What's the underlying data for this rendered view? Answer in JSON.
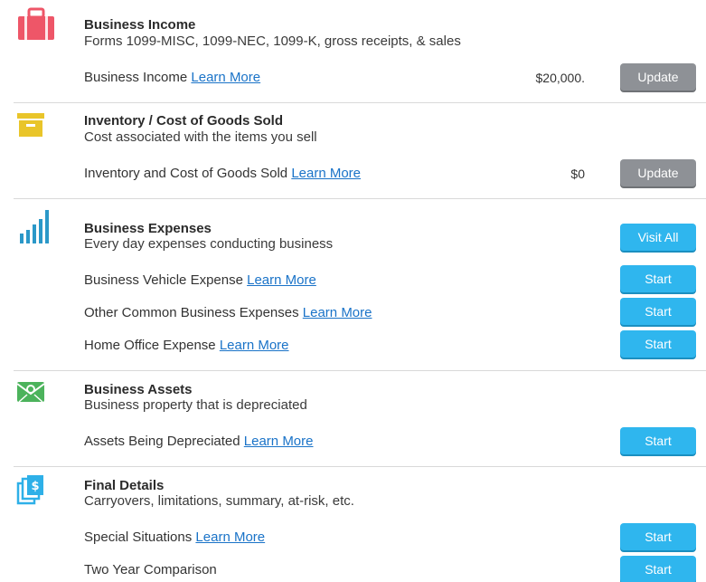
{
  "colors": {
    "briefcase": "#ee5668",
    "inventory": "#e9c52a",
    "expenses": "#2b98c8",
    "assets": "#4cb35c",
    "final": "#2eb0e8",
    "update_button": "#8e9196",
    "start_button": "#2fb6ee",
    "link": "#1a73c8"
  },
  "sections": {
    "income": {
      "icon": "briefcase-icon",
      "title": "Business Income",
      "subtitle": "Forms 1099-MISC, 1099-NEC, 1099-K, gross receipts, & sales",
      "rows": [
        {
          "label": "Business Income",
          "link": "Learn More",
          "amount": "$20,000.",
          "button": "Update"
        }
      ]
    },
    "inventory": {
      "icon": "archive-box-icon",
      "title": "Inventory / Cost of Goods Sold",
      "subtitle": "Cost associated with the items you sell",
      "rows": [
        {
          "label": "Inventory and Cost of Goods Sold",
          "link": "Learn More",
          "amount": "$0",
          "button": "Update"
        }
      ]
    },
    "expenses": {
      "icon": "bar-chart-icon",
      "title": "Business Expenses",
      "subtitle": "Every day expenses conducting business",
      "header_button": "Visit All",
      "rows": [
        {
          "label": "Business Vehicle Expense",
          "link": "Learn More",
          "button": "Start"
        },
        {
          "label": "Other Common Business Expenses",
          "link": "Learn More",
          "button": "Start"
        },
        {
          "label": "Home Office Expense",
          "link": "Learn More",
          "button": "Start"
        }
      ]
    },
    "assets": {
      "icon": "money-envelope-icon",
      "title": "Business Assets",
      "subtitle": "Business property that is depreciated",
      "rows": [
        {
          "label": "Assets Being Depreciated",
          "link": "Learn More",
          "button": "Start"
        }
      ]
    },
    "final": {
      "icon": "stacked-documents-dollar-icon",
      "title": "Final Details",
      "subtitle": "Carryovers, limitations, summary, at-risk, etc.",
      "rows": [
        {
          "label": "Special Situations",
          "link": "Learn More",
          "button": "Start"
        },
        {
          "label": "Two Year Comparison",
          "link": "",
          "button": "Start"
        }
      ]
    }
  }
}
